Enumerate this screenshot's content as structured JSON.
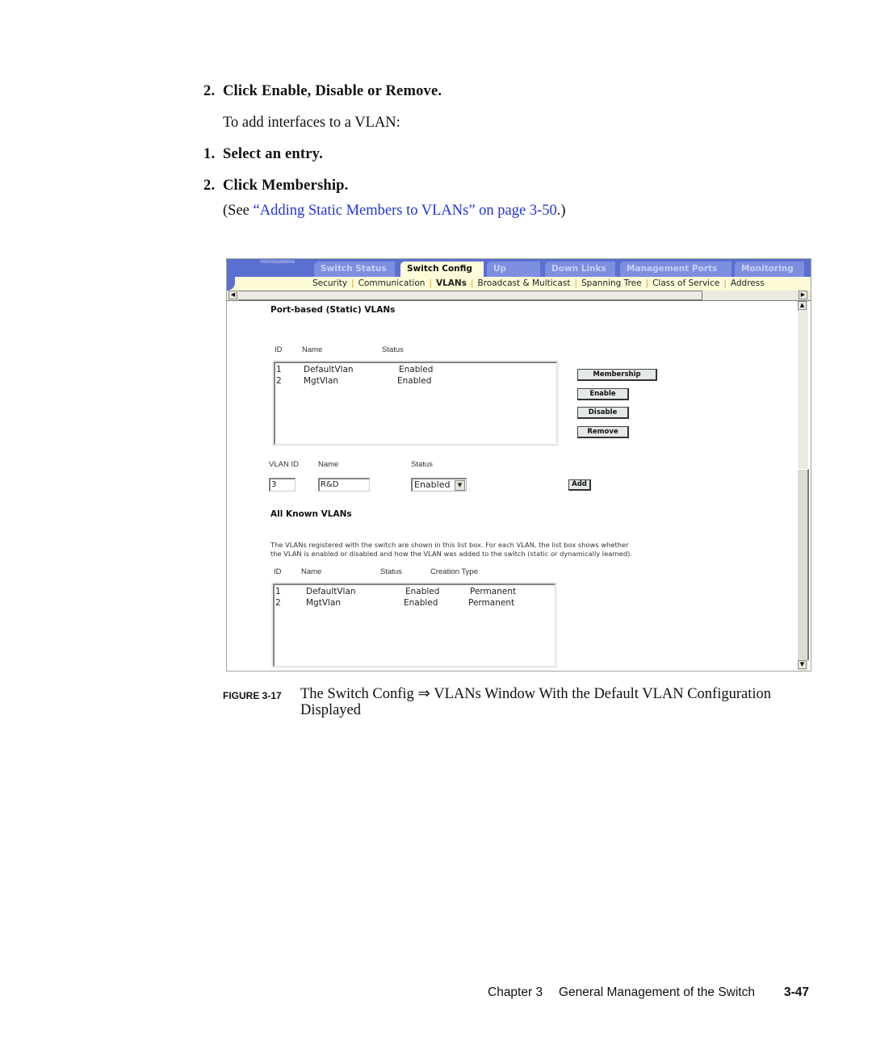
{
  "doc": {
    "steps": [
      {
        "num": "2.",
        "text": "Click Enable, Disable or Remove."
      },
      {
        "num": "1.",
        "text": "Select an entry."
      },
      {
        "num": "2.",
        "text": "Click Membership."
      }
    ],
    "intro": "To add interfaces to a VLAN:",
    "see_prefix": "(See ",
    "see_link": "“Adding Static Members to VLANs” on page 3-50",
    "see_suffix": ".)",
    "link_color": "#2233dd"
  },
  "screenshot": {
    "brand": "microsystems",
    "tabs": [
      {
        "label": "Switch Status",
        "active": false
      },
      {
        "label": "Switch Config",
        "active": true
      },
      {
        "label": "Up Links",
        "active": false
      },
      {
        "label": "Down Links",
        "active": false
      },
      {
        "label": "Management Ports",
        "active": false
      },
      {
        "label": "Monitoring",
        "active": false
      }
    ],
    "sublinks": [
      {
        "label": "Security",
        "current": false
      },
      {
        "label": "Communication",
        "current": false
      },
      {
        "label": "VLANs",
        "current": true
      },
      {
        "label": "Broadcast & Multicast",
        "current": false
      },
      {
        "label": "Spanning Tree",
        "current": false
      },
      {
        "label": "Class of Service",
        "current": false
      },
      {
        "label": "Address",
        "current": false
      }
    ],
    "static_section": {
      "title": "Port-based (Static) VLANs",
      "headers": {
        "id": "ID",
        "name": "Name",
        "status": "Status"
      },
      "rows": [
        {
          "id": "1",
          "name": "DefaultVlan",
          "status": "Enabled"
        },
        {
          "id": "2",
          "name": "MgtVlan",
          "status": "Enabled"
        }
      ],
      "buttons": {
        "membership": "Membership",
        "enable": "Enable",
        "disable": "Disable",
        "remove": "Remove"
      }
    },
    "add_form": {
      "labels": {
        "vlan_id": "VLAN ID",
        "name": "Name",
        "status": "Status"
      },
      "vlan_id_value": "3",
      "name_value": "R&D",
      "status_value": "Enabled",
      "add_label": "Add"
    },
    "known_section": {
      "title": "All Known VLANs",
      "description_line1": "The VLANs registered with the switch are shown in this list box. For each VLAN, the list box shows whether",
      "description_line2": "the VLAN is enabled or disabled and how the VLAN was added to the switch (static or dynamically learned).",
      "headers": {
        "id": "ID",
        "name": "Name",
        "status": "Status",
        "creation": "Creation Type"
      },
      "rows": [
        {
          "id": "1",
          "name": "DefaultVlan",
          "status": "Enabled",
          "creation": "Permanent"
        },
        {
          "id": "2",
          "name": "MgtVlan",
          "status": "Enabled",
          "creation": "Permanent"
        }
      ]
    },
    "colors": {
      "topbar": "#5b6fd0",
      "active_tab": "#fdfbd8",
      "separator": "#e0a030"
    }
  },
  "caption": {
    "figure_label": "FIGURE 3-17",
    "text": "The Switch Config ⇒ VLANs Window With the Default VLAN Configuration Displayed"
  },
  "footer": {
    "chapter": "Chapter 3",
    "title": "General Management of the Switch",
    "page": "3-47"
  }
}
